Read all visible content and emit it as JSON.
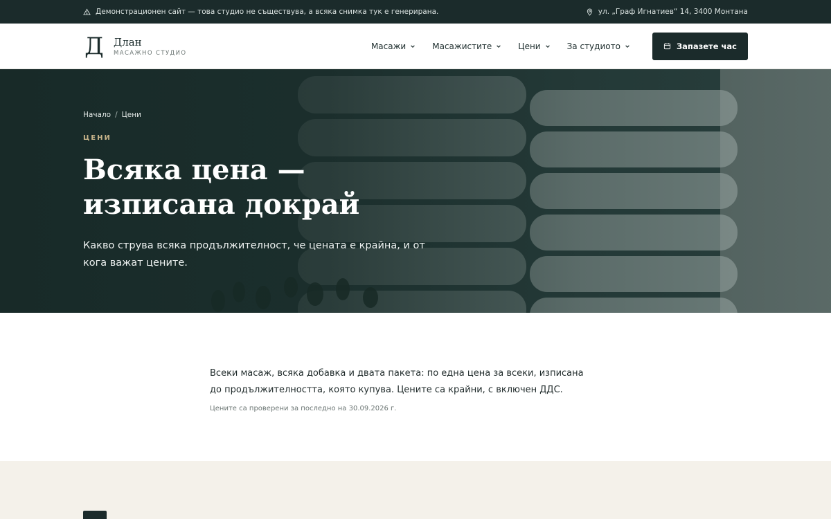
{
  "topbar": {
    "notice": "Демонстрационен сайт — това студио не съществува, а всяка снимка тук е генерирана.",
    "address": "ул. „Граф Игнатиев“ 14, 3400 Монтана",
    "notice_icon": "warning-icon",
    "address_icon": "map-pin-icon"
  },
  "brand": {
    "mark": "Д",
    "name": "Длан",
    "subtitle": "МАСАЖНО СТУДИО"
  },
  "nav": {
    "items": [
      {
        "label": "Масажи"
      },
      {
        "label": "Масажистите"
      },
      {
        "label": "Цени"
      },
      {
        "label": "За студиото"
      }
    ],
    "cta_label": "Запазете час",
    "cta_icon": "calendar-icon"
  },
  "hero": {
    "breadcrumb": {
      "home": "Начало",
      "separator": "/",
      "current": "Цени"
    },
    "eyebrow": "ЦЕНИ",
    "title_line1": "Всяка цена —",
    "title_line2": "изписана докрай",
    "lead": "Какво струва всяка продължителност, че цената е крайна, и от кога важат цените."
  },
  "intro": {
    "text": "Всеки масаж, всяка добавка и двата пакета: по една цена за всеки, изписана до продължителността, която купува. Цените са крайни, с включен ДДС.",
    "note": "Цените са проверени за последно на 30.09.2026 г."
  },
  "colors": {
    "dark": "#1b2b2b",
    "accent": "#c7b48a",
    "beige": "#f4f1ea"
  }
}
